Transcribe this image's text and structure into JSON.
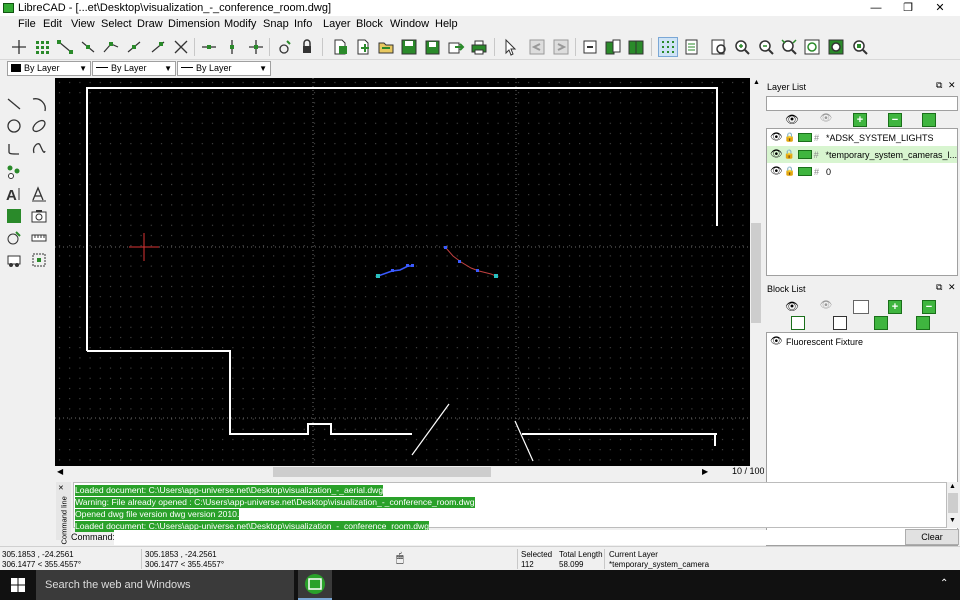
{
  "window": {
    "title": "LibreCAD - [...et\\Desktop\\visualization_-_conference_room.dwg]",
    "minimize": "—",
    "restore": "❐",
    "close": "✕"
  },
  "menu": [
    "File",
    "Edit",
    "View",
    "Select",
    "Draw",
    "Dimension",
    "Modify",
    "Snap",
    "Info",
    "Layer",
    "Block",
    "Window",
    "Help"
  ],
  "pen": {
    "color": "By Layer",
    "width": "By Layer",
    "linetype": "By Layer"
  },
  "layer_list": {
    "title": "Layer List",
    "layers": [
      {
        "name": "*ADSK_SYSTEM_LIGHTS"
      },
      {
        "name": "*temporary_system_cameras_l..."
      },
      {
        "name": "0"
      }
    ]
  },
  "block_list": {
    "title": "Block List",
    "blocks": [
      {
        "name": "Fluorescent Fixture"
      }
    ]
  },
  "canvas": {
    "zoom_label": "10 / 100"
  },
  "command": {
    "dock_label": "Command line",
    "history": [
      "Loaded document: C:\\Users\\app-universe.net\\Desktop\\visualization_-_aerial.dwg",
      "Warning: File already opened : C:\\Users\\app-universe.net\\Desktop\\visualization_-_conference_room.dwg",
      "Opened dwg file version dwg version 2010.",
      "Loaded document: C:\\Users\\app-universe.net\\Desktop\\visualization_-_conference_room.dwg"
    ],
    "label": "Command:",
    "value": "",
    "clear_label": "Clear"
  },
  "status": {
    "abs_coord_1": "305.1853 , -24.2561",
    "abs_coord_2": "306.1477 < 355.4557°",
    "rel_coord_1": "305.1853 , -24.2561",
    "rel_coord_2": "306.1477 < 355.4557°",
    "selected_label": "Selected",
    "selected_value": "112",
    "total_length_label": "Total Length",
    "total_length_value": "58.099",
    "current_layer_label": "Current Layer",
    "current_layer_value": "*temporary_system_camera"
  },
  "taskbar": {
    "search_placeholder": "Search the web and Windows"
  },
  "colors": {
    "accent_green": "#2aa12a",
    "canvas_bg": "#000000",
    "highlight_row": "#d8f5d0"
  }
}
